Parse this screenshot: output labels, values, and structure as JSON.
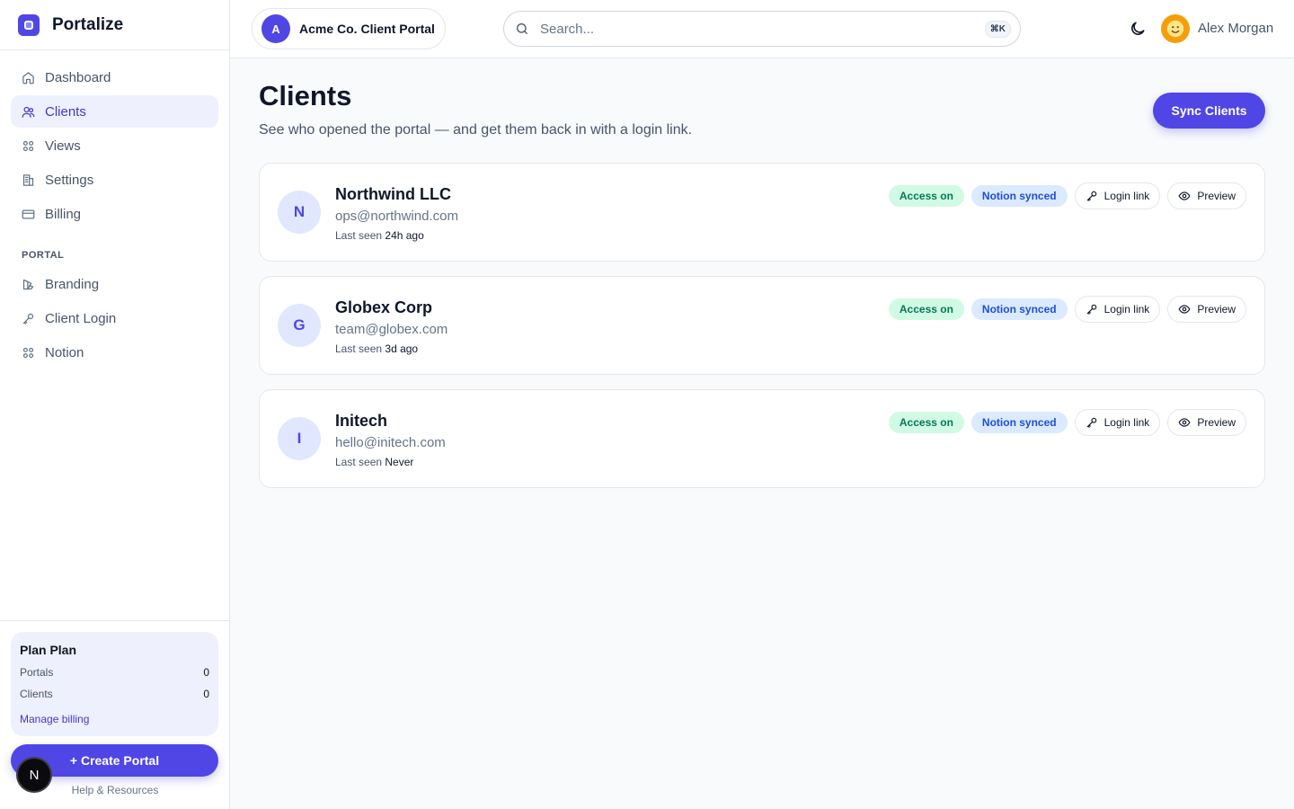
{
  "brand": {
    "name": "Portalize"
  },
  "sidebar": {
    "items": [
      {
        "label": "Dashboard",
        "icon": "home-icon"
      },
      {
        "label": "Clients",
        "icon": "users-icon"
      },
      {
        "label": "Views",
        "icon": "grid-icon"
      },
      {
        "label": "Settings",
        "icon": "building-icon"
      },
      {
        "label": "Billing",
        "icon": "credit-card-icon"
      }
    ],
    "section_label": "PORTAL",
    "portal_items": [
      {
        "label": "Branding",
        "icon": "palette-icon"
      },
      {
        "label": "Client Login",
        "icon": "key-icon"
      },
      {
        "label": "Notion",
        "icon": "grid-icon"
      }
    ],
    "plan": {
      "title": "Plan Plan",
      "portals_label": "Portals",
      "portals_value": "0",
      "clients_label": "Clients",
      "clients_value": "0",
      "manage_label": "Manage billing"
    },
    "create_label": "+ Create Portal",
    "help_label": "Help & Resources",
    "n_badge": "N"
  },
  "header": {
    "portal_initial": "A",
    "portal_name": "Acme Co. Client Portal",
    "search_placeholder": "Search...",
    "shortcut": "⌘K",
    "user_name": "Alex Morgan"
  },
  "main": {
    "title": "Clients",
    "subtitle": "See who opened the portal — and get them back in with a login link.",
    "sync_label": "Sync Clients",
    "access_label": "Access on",
    "notion_label": "Notion synced",
    "login_link_label": "Login link",
    "preview_label": "Preview",
    "last_seen_label": "Last seen",
    "clients": [
      {
        "initial": "N",
        "name": "Northwind LLC",
        "email": "ops@northwind.com",
        "last_seen": "24h ago"
      },
      {
        "initial": "G",
        "name": "Globex Corp",
        "email": "team@globex.com",
        "last_seen": "3d ago"
      },
      {
        "initial": "I",
        "name": "Initech",
        "email": "hello@initech.com",
        "last_seen": "Never"
      }
    ]
  },
  "colors": {
    "accent": "#4f46e5",
    "access_bg": "#d1fae5",
    "notion_bg": "#dbeafe"
  }
}
